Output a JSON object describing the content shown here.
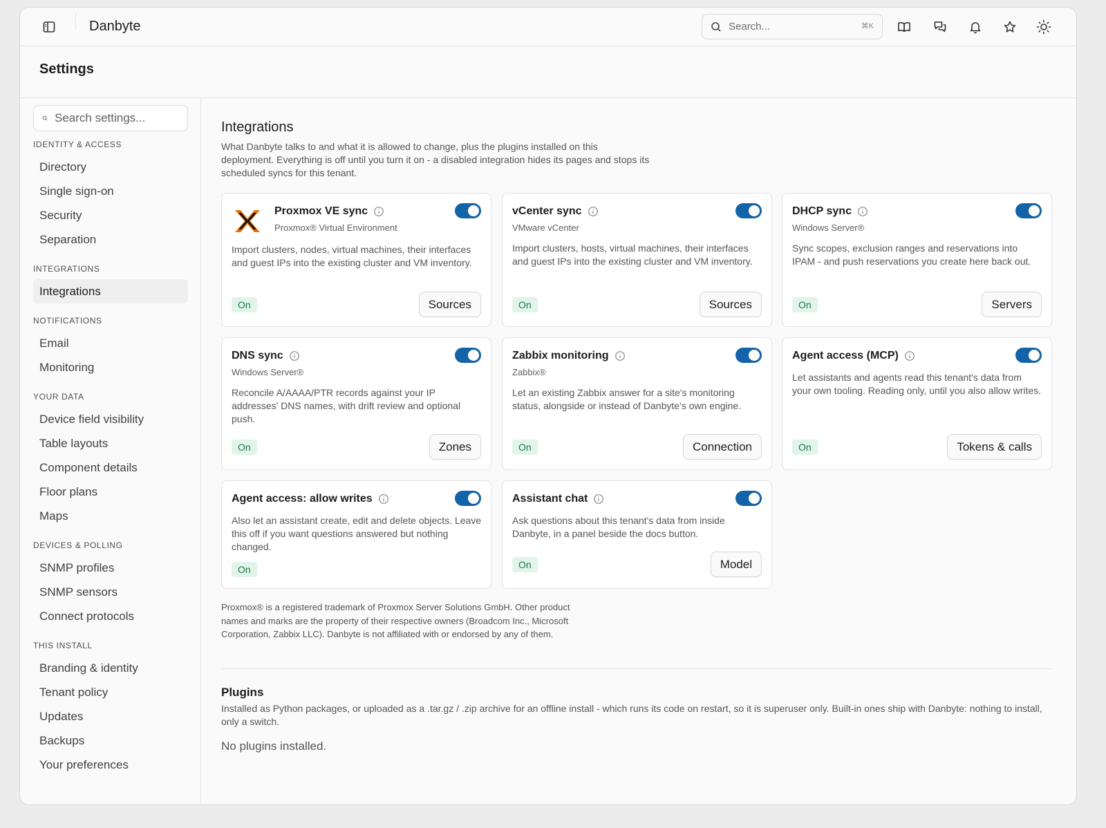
{
  "app": {
    "title": "Danbyte"
  },
  "topbar": {
    "search_placeholder": "Search...",
    "search_shortcut": "⌘K",
    "icons": [
      "sidebar-toggle-icon",
      "book-icon",
      "chat-icon",
      "bell-icon",
      "star-icon",
      "sun-icon"
    ]
  },
  "page": {
    "title": "Settings"
  },
  "sidebar": {
    "search_placeholder": "Search settings...",
    "sections": [
      {
        "title": "IDENTITY & ACCESS",
        "items": [
          "Directory",
          "Single sign-on",
          "Security",
          "Separation"
        ]
      },
      {
        "title": "INTEGRATIONS",
        "items": [
          "Integrations"
        ]
      },
      {
        "title": "NOTIFICATIONS",
        "items": [
          "Email",
          "Monitoring"
        ]
      },
      {
        "title": "YOUR DATA",
        "items": [
          "Device field visibility",
          "Table layouts",
          "Component details",
          "Floor plans",
          "Maps"
        ]
      },
      {
        "title": "DEVICES & POLLING",
        "items": [
          "SNMP profiles",
          "SNMP sensors",
          "Connect protocols"
        ]
      },
      {
        "title": "THIS INSTALL",
        "items": [
          "Branding & identity",
          "Tenant policy",
          "Updates",
          "Backups",
          "Your preferences"
        ]
      }
    ],
    "active_item": "Integrations"
  },
  "integrations": {
    "title": "Integrations",
    "description": "What Danbyte talks to and what it is allowed to change, plus the plugins installed on this deployment. Everything is off until you turn it on - a disabled integration hides its pages and stops its scheduled syncs for this tenant.",
    "cards": [
      {
        "title": "Proxmox VE sync",
        "subtitle": "Proxmox® Virtual Environment",
        "description": "Import clusters, nodes, virtual machines, their interfaces and guest IPs into the existing cluster and VM inventory.",
        "status": "On",
        "button": "Sources",
        "enabled": true,
        "has_logo": true
      },
      {
        "title": "vCenter sync",
        "subtitle": "VMware vCenter",
        "description": "Import clusters, hosts, virtual machines, their interfaces and guest IPs into the existing cluster and VM inventory.",
        "status": "On",
        "button": "Sources",
        "enabled": true
      },
      {
        "title": "DHCP sync",
        "subtitle": "Windows Server®",
        "description": "Sync scopes, exclusion ranges and reservations into IPAM - and push reservations you create here back out.",
        "status": "On",
        "button": "Servers",
        "enabled": true
      },
      {
        "title": "DNS sync",
        "subtitle": "Windows Server®",
        "description": "Reconcile A/AAAA/PTR records against your IP addresses' DNS names, with drift review and optional push.",
        "status": "On",
        "button": "Zones",
        "enabled": true
      },
      {
        "title": "Zabbix monitoring",
        "subtitle": "Zabbix®",
        "description": "Let an existing Zabbix answer for a site's monitoring status, alongside or instead of Danbyte's own engine.",
        "status": "On",
        "button": "Connection",
        "enabled": true
      },
      {
        "title": "Agent access (MCP)",
        "subtitle": "",
        "description": "Let assistants and agents read this tenant's data from your own tooling. Reading only, until you also allow writes.",
        "status": "On",
        "button": "Tokens & calls",
        "enabled": true
      },
      {
        "title": "Agent access: allow writes",
        "subtitle": "",
        "description": "Also let an assistant create, edit and delete objects. Leave this off if you want questions answered but nothing changed.",
        "status": "On",
        "button": "",
        "enabled": true
      },
      {
        "title": "Assistant chat",
        "subtitle": "",
        "description": "Ask questions about this tenant's data from inside Danbyte, in a panel beside the docs button.",
        "status": "On",
        "button": "Model",
        "enabled": true
      }
    ],
    "trademark_note": "Proxmox® is a registered trademark of Proxmox Server Solutions GmbH. Other product names and marks are the property of their respective owners (Broadcom Inc., Microsoft Corporation, Zabbix LLC). Danbyte is not affiliated with or endorsed by any of them."
  },
  "plugins": {
    "title": "Plugins",
    "description": "Installed as Python packages, or uploaded as a .tar.gz / .zip archive for an offline install - which runs its code on restart, so it is superuser only. Built-in ones ship with Danbyte: nothing to install, only a switch.",
    "empty_text": "No plugins installed."
  },
  "colors": {
    "accent": "#1363a8",
    "status_on_bg": "#e1f4ea",
    "status_on_text": "#1c7a45",
    "logo_orange": "#e57000"
  }
}
